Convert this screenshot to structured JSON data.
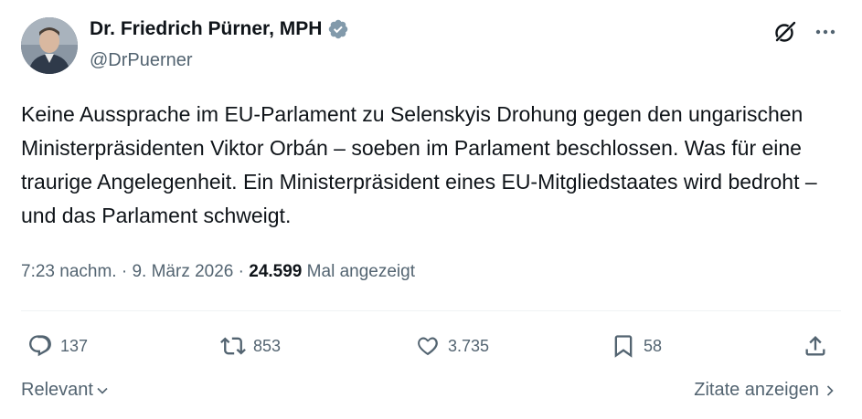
{
  "author": {
    "name": "Dr. Friedrich Pürner, MPH",
    "handle": "@DrPuerner"
  },
  "tweet": {
    "text": "Keine Aussprache im EU-Parlament zu Selenskyis Drohung gegen den ungarischen Ministerpräsidenten Viktor Orbán – soeben im Parlament beschlossen. Was für eine traurige Angelegenheit. Ein Ministerpräsident eines EU-Mitgliedstaates wird bedroht – und das Parlament schweigt."
  },
  "meta": {
    "time": "7:23 nachm.",
    "separator": " · ",
    "date": "9. März 2026",
    "separator2": " · ",
    "views_count": "24.599",
    "views_label": "Mal angezeigt"
  },
  "actions": {
    "replies": "137",
    "reposts": "853",
    "likes": "3.735",
    "bookmarks": "58"
  },
  "footer": {
    "sort_label": "Relevant",
    "quotes_label": "Zitate anzeigen"
  },
  "colors": {
    "verified": "#829aab",
    "muted": "#536471",
    "text": "#0f1419"
  },
  "icons": [
    "verified-badge-icon",
    "grok-icon",
    "more-icon",
    "reply-icon",
    "repost-icon",
    "like-icon",
    "bookmark-icon",
    "share-icon",
    "chevron-down-icon",
    "chevron-right-icon"
  ]
}
